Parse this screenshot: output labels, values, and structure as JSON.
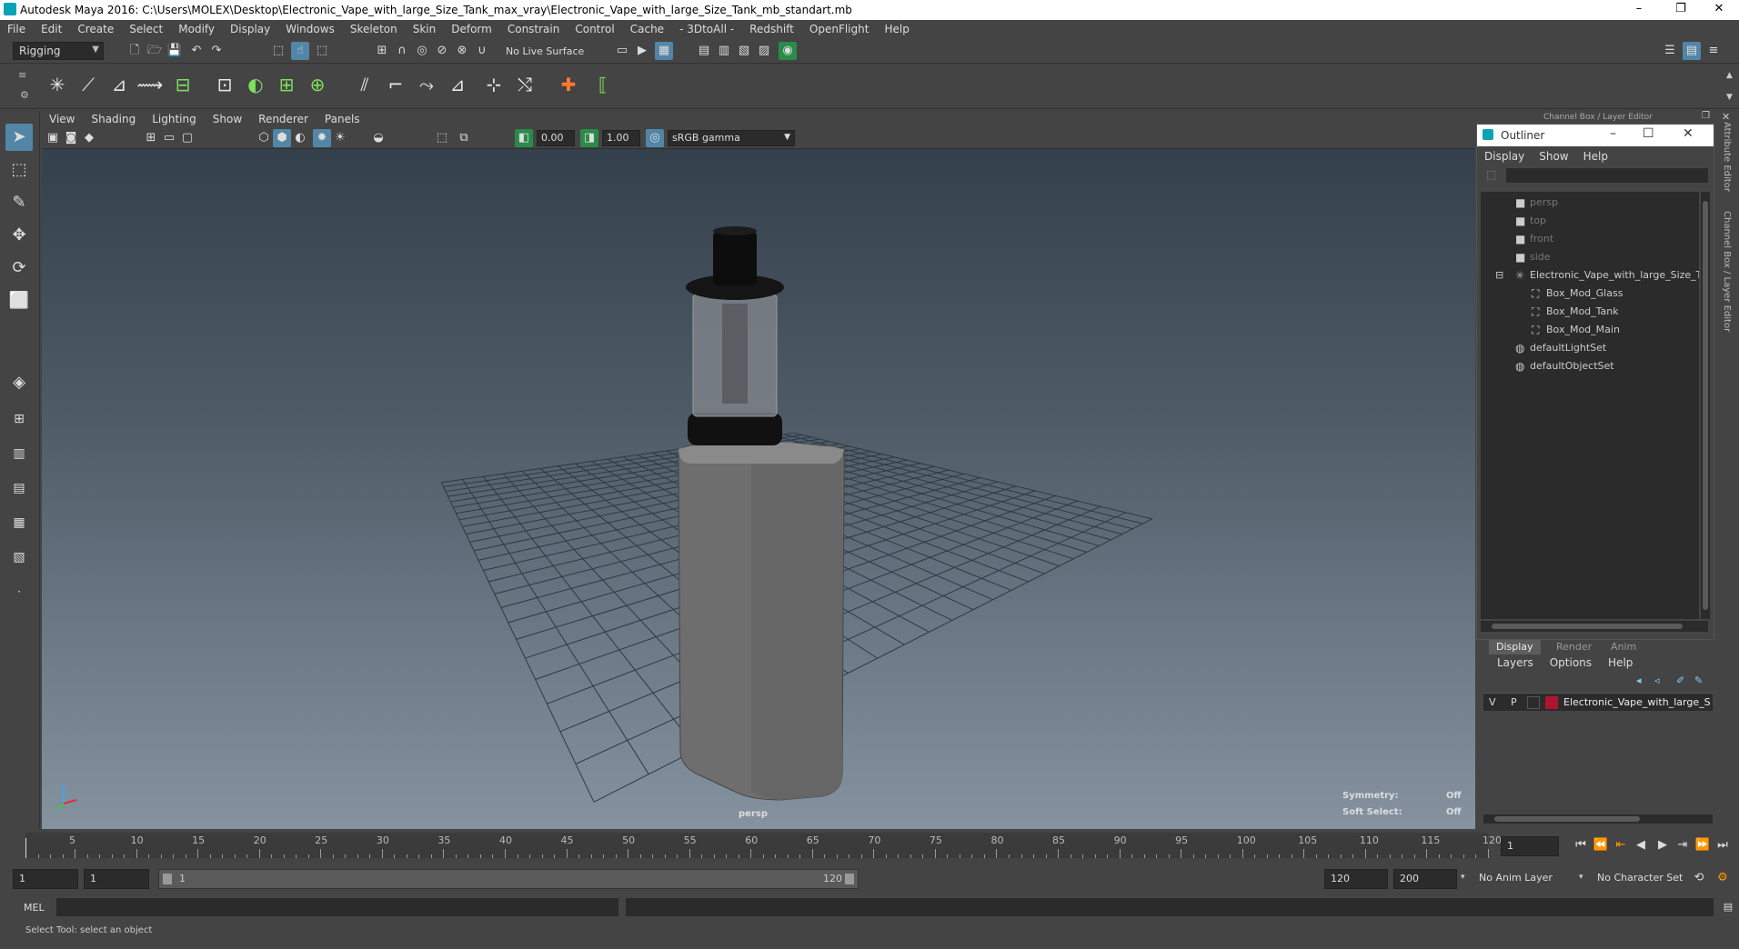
{
  "title_bar": {
    "title": "Autodesk Maya 2016: C:\\Users\\MOLEX\\Desktop\\Electronic_Vape_with_large_Size_Tank_max_vray\\Electronic_Vape_with_large_Size_Tank_mb_standart.mb",
    "minimize": "–",
    "restore": "❐",
    "close": "✕"
  },
  "menu": [
    "File",
    "Edit",
    "Create",
    "Select",
    "Modify",
    "Display",
    "Windows",
    "Skeleton",
    "Skin",
    "Deform",
    "Constrain",
    "Control",
    "Cache",
    "- 3DtoAll -",
    "Redshift",
    "OpenFlight",
    "Help"
  ],
  "status_line": {
    "mode": "Rigging",
    "live_surface": "No Live Surface"
  },
  "viewport": {
    "menu": [
      "View",
      "Shading",
      "Lighting",
      "Show",
      "Renderer",
      "Panels"
    ],
    "exposure": "0.00",
    "gamma": "1.00",
    "color_space": "sRGB gamma",
    "camera_label": "persp",
    "symmetry_label": "Symmetry:",
    "symmetry_value": "Off",
    "soft_select_label": "Soft Select:",
    "soft_select_value": "Off"
  },
  "outliner": {
    "title": "Outliner",
    "menu": [
      "Display",
      "Show",
      "Help"
    ],
    "items": [
      {
        "label": "persp",
        "icon": "camera-icon",
        "dim": true
      },
      {
        "label": "top",
        "icon": "camera-icon",
        "dim": true
      },
      {
        "label": "front",
        "icon": "camera-icon",
        "dim": true
      },
      {
        "label": "side",
        "icon": "camera-icon",
        "dim": true
      },
      {
        "label": "Electronic_Vape_with_large_Size_Ta",
        "icon": "group-icon",
        "dim": false
      },
      {
        "label": "Box_Mod_Glass",
        "icon": "mesh-icon",
        "dim": false
      },
      {
        "label": "Box_Mod_Tank",
        "icon": "mesh-icon",
        "dim": false
      },
      {
        "label": "Box_Mod_Main",
        "icon": "mesh-icon",
        "dim": false
      },
      {
        "label": "defaultLightSet",
        "icon": "set-icon",
        "dim": false
      },
      {
        "label": "defaultObjectSet",
        "icon": "set-icon",
        "dim": false
      }
    ]
  },
  "right_panel": {
    "channel_box_title": "Channel Box / Layer Editor",
    "attribute_editor": "Attribute Editor",
    "channel_box_vertical": "Channel Box / Layer Editor"
  },
  "layer_editor": {
    "tabs": [
      "Display",
      "Render",
      "Anim"
    ],
    "menu": [
      "Layers",
      "Options",
      "Help"
    ],
    "layer": {
      "v": "V",
      "p": "P",
      "name": "Electronic_Vape_with_large_Size",
      "color": "#b01530"
    }
  },
  "timeline": {
    "labels": [
      "5",
      "10",
      "15",
      "20",
      "25",
      "30",
      "35",
      "40",
      "45",
      "50",
      "55",
      "60",
      "65",
      "70",
      "75",
      "80",
      "85",
      "90",
      "95",
      "100",
      "105",
      "110",
      "115",
      "120"
    ],
    "start_marker": "1",
    "current_frame": "1"
  },
  "range": {
    "start": "1",
    "playback_start": "1",
    "slider_start": "1",
    "slider_end": "120",
    "playback_end": "120",
    "end": "200",
    "anim_layer": "No Anim Layer",
    "character_set": "No Character Set"
  },
  "command_line": {
    "label": "MEL"
  },
  "help_line": {
    "text": "Select Tool: select an object"
  }
}
